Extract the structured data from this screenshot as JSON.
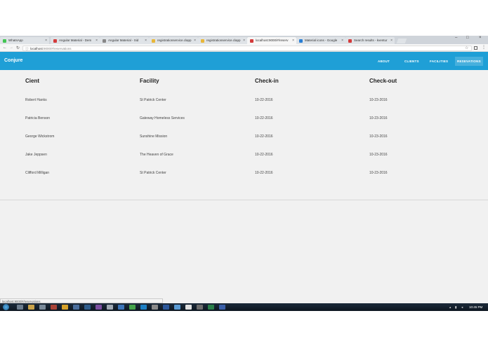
{
  "browser": {
    "tabs": [
      {
        "title": "WhatsApp",
        "active": false,
        "favicon_color": "#43c553"
      },
      {
        "title": "Angular Material - Dem",
        "active": false,
        "favicon_color": "#d33b3b"
      },
      {
        "title": "Angular Material - Sid",
        "active": false,
        "favicon_color": "#888888"
      },
      {
        "title": "registrationservice.clapp",
        "active": false,
        "favicon_color": "#e8b73a"
      },
      {
        "title": "registrationservice.clapp",
        "active": false,
        "favicon_color": "#e8b73a"
      },
      {
        "title": "localhost:9000/#/reserv",
        "active": true,
        "favicon_color": "#d33b3b"
      },
      {
        "title": "Material icons - Google",
        "active": false,
        "favicon_color": "#2a7fd4"
      },
      {
        "title": "Search results - kventur",
        "active": false,
        "favicon_color": "#d33b3b"
      }
    ],
    "close_glyph": "×",
    "url_host": "localhost",
    "url_path": ":9000/#/reservations",
    "status_url": "localhost:9000/#/reservations"
  },
  "app": {
    "brand": "Conjure",
    "nav": [
      {
        "label": "ABOUT",
        "active": false
      },
      {
        "label": "CLIENTS",
        "active": false
      },
      {
        "label": "FACILITIES",
        "active": false
      },
      {
        "label": "RESEVATIONS",
        "active": true
      }
    ]
  },
  "table": {
    "columns": [
      "Cient",
      "Facility",
      "Check-in",
      "Check-out"
    ],
    "rows": [
      [
        "Robert Hanks",
        "St Patrick Center",
        "10-22-2016",
        "10-23-2016"
      ],
      [
        "Patricia Benson",
        "Gateway Homeless Services",
        "10-22-2016",
        "10-23-2016"
      ],
      [
        "George Wickstrom",
        "Sunshine Mission",
        "10-22-2016",
        "10-23-2016"
      ],
      [
        "Jake Jeppsen",
        "The Heaven of Grace",
        "10-22-2016",
        "10-23-2016"
      ],
      [
        "Clifford Milligan",
        "St Patrick Center",
        "10-22-2016",
        "10-23-2016"
      ]
    ]
  },
  "taskbar": {
    "clock": "10:45 PM",
    "icon_colors": [
      "#6b7b8c",
      "#c9a24a",
      "#7a8a9a",
      "#a94438",
      "#d6a12a",
      "#4a6e9c",
      "#2f5d8c",
      "#7b4fa0",
      "#9fa8b2",
      "#3c74b8",
      "#44a34a",
      "#1d7fc4",
      "#8a8a8a",
      "#2b579a",
      "#5a9bd4",
      "#e0e0e0",
      "#6c6c6c",
      "#2a7f4a",
      "#3a5fa8"
    ]
  }
}
